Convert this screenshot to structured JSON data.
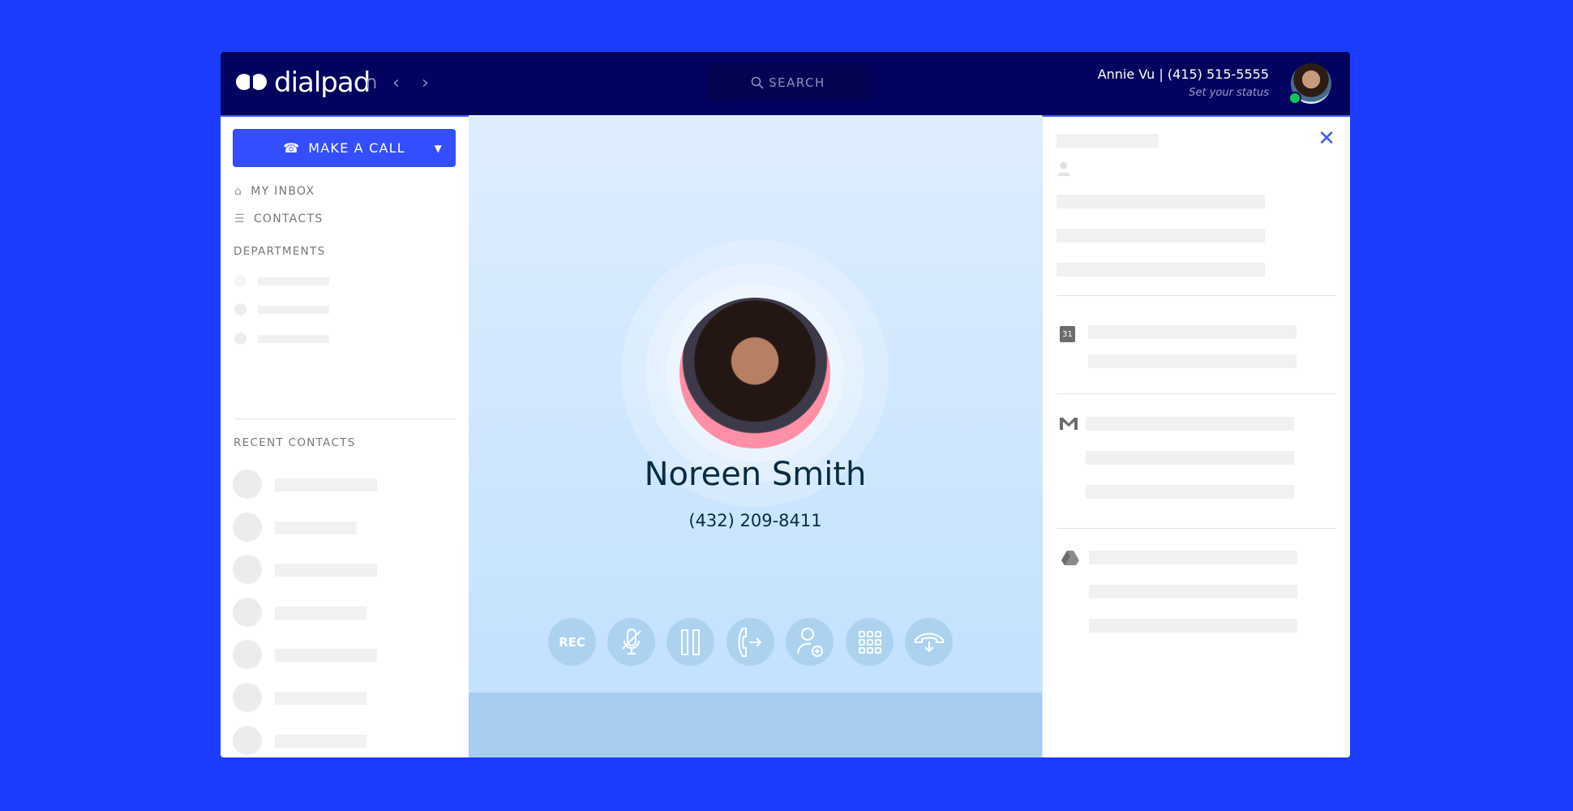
{
  "header": {
    "brand": "dialpad",
    "search_label": "SEARCH",
    "user_line": "Annie Vu | (415) 515-5555",
    "status_placeholder": "Set your status",
    "status_color": "#13c35a"
  },
  "sidebar": {
    "make_call_label": "MAKE A CALL",
    "nav": [
      {
        "label": "MY INBOX",
        "icon": "home-icon"
      },
      {
        "label": "CONTACTS",
        "icon": "contacts-icon"
      }
    ],
    "departments_label": "DEPARTMENTS",
    "recent_label": "RECENT CONTACTS"
  },
  "call": {
    "name": "Noreen Smith",
    "phone": "(432) 209-8411",
    "controls": [
      {
        "name": "record",
        "label": "REC"
      },
      {
        "name": "mute"
      },
      {
        "name": "hold"
      },
      {
        "name": "transfer"
      },
      {
        "name": "add-participant"
      },
      {
        "name": "keypad"
      },
      {
        "name": "hangup"
      }
    ]
  },
  "colors": {
    "accent": "#334dff",
    "header": "#02035e",
    "background": "#1d3bff"
  }
}
